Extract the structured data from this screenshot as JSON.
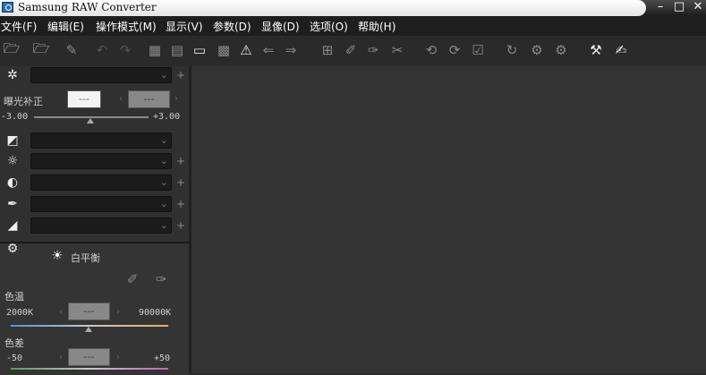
{
  "window": {
    "title": "Samsung RAW Converter",
    "minimize": "–",
    "maximize": "□",
    "close": "✕"
  },
  "menu": [
    {
      "label": "文件(F)"
    },
    {
      "label": "编辑(E)"
    },
    {
      "label": "操作模式(M)"
    },
    {
      "label": "显示(V)"
    },
    {
      "label": "参数(D)"
    },
    {
      "label": "显像(D)"
    },
    {
      "label": "选项(O)"
    },
    {
      "label": "帮助(H)"
    }
  ],
  "toolbar": {
    "icons": [
      "open-folder-icon",
      "open-folder-dropdown-icon",
      "eraser-icon",
      "undo-icon",
      "redo-icon",
      "grid-view-icon",
      "compare-view-icon",
      "single-view-icon",
      "checker-icon",
      "warning-icon",
      "prev-image-icon",
      "next-image-icon",
      "crop-grid-icon",
      "pipette-icon",
      "pipette-plus-icon",
      "scissors-icon",
      "rotate-left-icon",
      "rotate-right-icon",
      "check-box-icon",
      "sync-icon",
      "settings-save-icon",
      "settings-check-icon",
      "hammer-icon",
      "edit-list-icon"
    ]
  },
  "panel": {
    "exposure": {
      "label": "曝光补正",
      "value_left": "---",
      "value_right": "---",
      "min": "-3.00",
      "max": "+3.00"
    },
    "tab": {
      "label": "白平衡",
      "temp_label": "色温",
      "temp_min": "2000K",
      "temp_max": "90000K",
      "temp_value": "---",
      "tint_label": "色差",
      "tint_min": "-50",
      "tint_max": "+50",
      "tint_value": "---"
    }
  }
}
